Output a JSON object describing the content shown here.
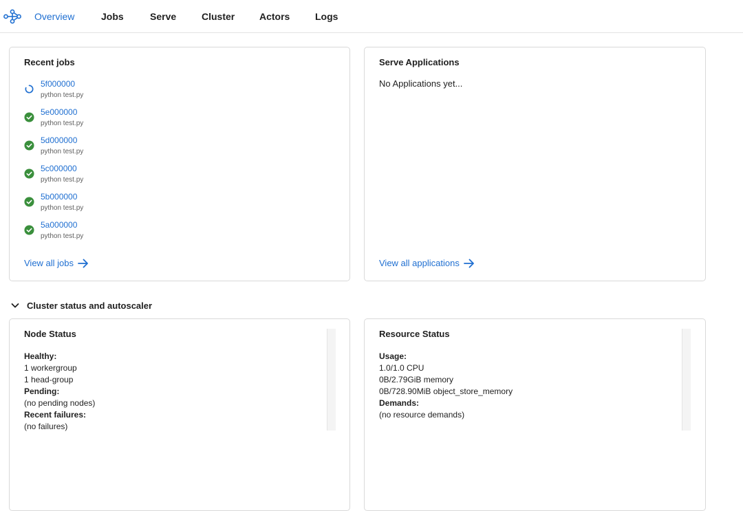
{
  "nav": {
    "items": [
      {
        "label": "Overview",
        "active": true
      },
      {
        "label": "Jobs",
        "active": false
      },
      {
        "label": "Serve",
        "active": false
      },
      {
        "label": "Cluster",
        "active": false
      },
      {
        "label": "Actors",
        "active": false
      },
      {
        "label": "Logs",
        "active": false
      }
    ]
  },
  "recent_jobs": {
    "title": "Recent jobs",
    "jobs": [
      {
        "id": "5f000000",
        "command": "python test.py",
        "status": "running"
      },
      {
        "id": "5e000000",
        "command": "python test.py",
        "status": "succeeded"
      },
      {
        "id": "5d000000",
        "command": "python test.py",
        "status": "succeeded"
      },
      {
        "id": "5c000000",
        "command": "python test.py",
        "status": "succeeded"
      },
      {
        "id": "5b000000",
        "command": "python test.py",
        "status": "succeeded"
      },
      {
        "id": "5a000000",
        "command": "python test.py",
        "status": "succeeded"
      }
    ],
    "view_all": "View all jobs"
  },
  "serve_apps": {
    "title": "Serve Applications",
    "empty": "No Applications yet...",
    "view_all": "View all applications"
  },
  "cluster_section": {
    "label": "Cluster status and autoscaler"
  },
  "node_status": {
    "title": "Node Status",
    "healthy_label": "Healthy:",
    "healthy": [
      "1 workergroup",
      "1 head-group"
    ],
    "pending_label": "Pending:",
    "pending": "(no pending nodes)",
    "failures_label": "Recent failures:",
    "failures": "(no failures)"
  },
  "resource_status": {
    "title": "Resource Status",
    "usage_label": "Usage:",
    "usage": [
      "1.0/1.0 CPU",
      "0B/2.79GiB memory",
      "0B/728.90MiB object_store_memory"
    ],
    "demands_label": "Demands:",
    "demands": "(no resource demands)"
  },
  "colors": {
    "accent": "#1f6fd1",
    "success": "#3a8f3c",
    "border": "#d9d9d9"
  },
  "icons": {
    "logo": "ray-logo-icon",
    "running": "spinner-icon",
    "succeeded": "check-circle-icon",
    "link_arrow": "arrow-right-icon",
    "collapse": "chevron-down-icon"
  }
}
